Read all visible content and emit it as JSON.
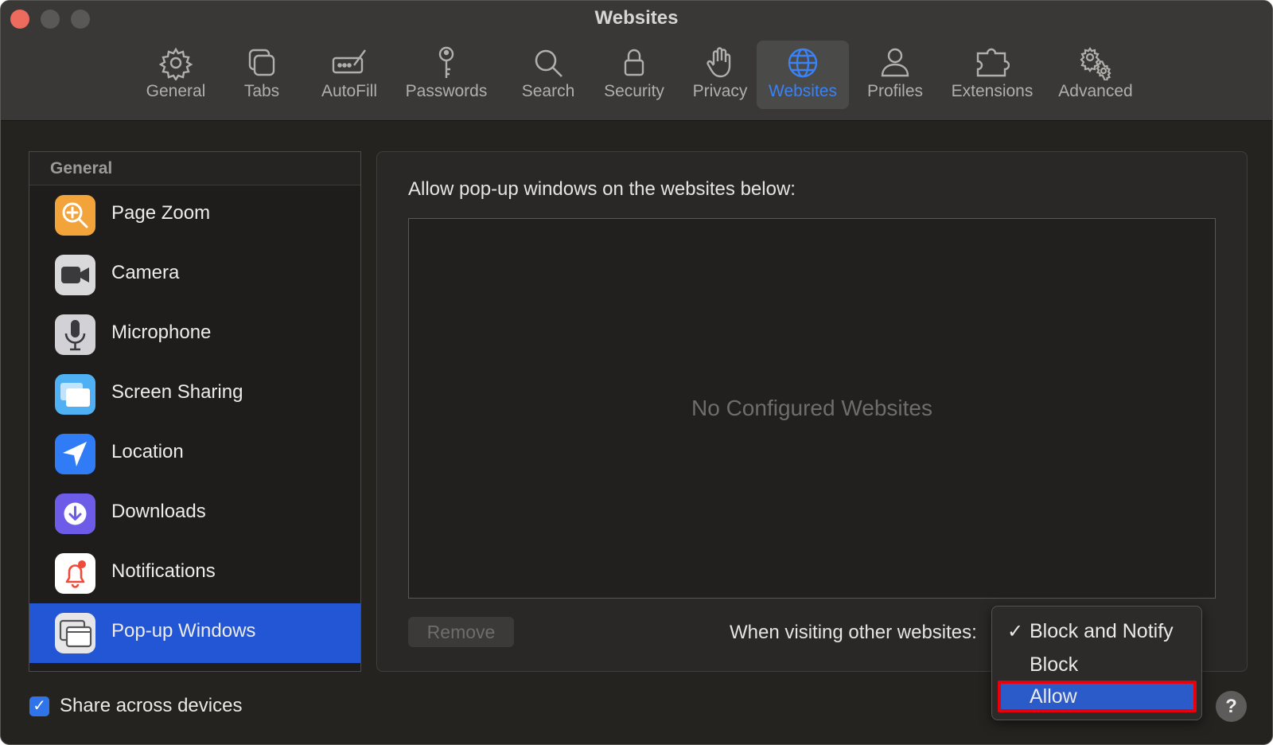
{
  "window": {
    "title": "Websites"
  },
  "toolbar": {
    "tabs": [
      {
        "label": "General",
        "icon": "gear-icon"
      },
      {
        "label": "Tabs",
        "icon": "tabs-icon"
      },
      {
        "label": "AutoFill",
        "icon": "autofill-icon"
      },
      {
        "label": "Passwords",
        "icon": "key-icon"
      },
      {
        "label": "Search",
        "icon": "search-icon"
      },
      {
        "label": "Security",
        "icon": "lock-icon"
      },
      {
        "label": "Privacy",
        "icon": "hand-icon"
      },
      {
        "label": "Websites",
        "icon": "globe-icon",
        "active": true
      },
      {
        "label": "Profiles",
        "icon": "person-icon"
      },
      {
        "label": "Extensions",
        "icon": "puzzle-icon"
      },
      {
        "label": "Advanced",
        "icon": "gears-icon"
      }
    ]
  },
  "sidebar": {
    "header": "General",
    "items": [
      {
        "label": "Page Zoom",
        "icon": "page-zoom-icon",
        "color": "#f2a33a"
      },
      {
        "label": "Camera",
        "icon": "camera-icon",
        "color": "#8e8e93"
      },
      {
        "label": "Microphone",
        "icon": "microphone-icon",
        "color": "#b8b8bc"
      },
      {
        "label": "Screen Sharing",
        "icon": "screen-sharing-icon",
        "color": "#5ab8f5"
      },
      {
        "label": "Location",
        "icon": "location-icon",
        "color": "#2f7cf6"
      },
      {
        "label": "Downloads",
        "icon": "downloads-icon",
        "color": "#6c5ce7"
      },
      {
        "label": "Notifications",
        "icon": "notifications-icon",
        "color": "#ffffff"
      },
      {
        "label": "Pop-up Windows",
        "icon": "popup-windows-icon",
        "color": "#e5e5e7",
        "selected": true
      }
    ]
  },
  "content": {
    "heading": "Allow pop-up windows on the websites below:",
    "empty_message": "No Configured Websites",
    "remove_label": "Remove",
    "visiting_label": "When visiting other websites:"
  },
  "dropdown": {
    "options": [
      {
        "label": "Block and Notify",
        "checked": true
      },
      {
        "label": "Block",
        "checked": false
      },
      {
        "label": "Allow",
        "checked": false,
        "highlighted": true
      }
    ],
    "check_glyph": "✓"
  },
  "footer": {
    "share_label": "Share across devices",
    "share_checked": true,
    "help_label": "?"
  },
  "colors": {
    "accent": "#2f74ea",
    "selection": "#2356d4",
    "highlight_outline": "#e8000d"
  }
}
